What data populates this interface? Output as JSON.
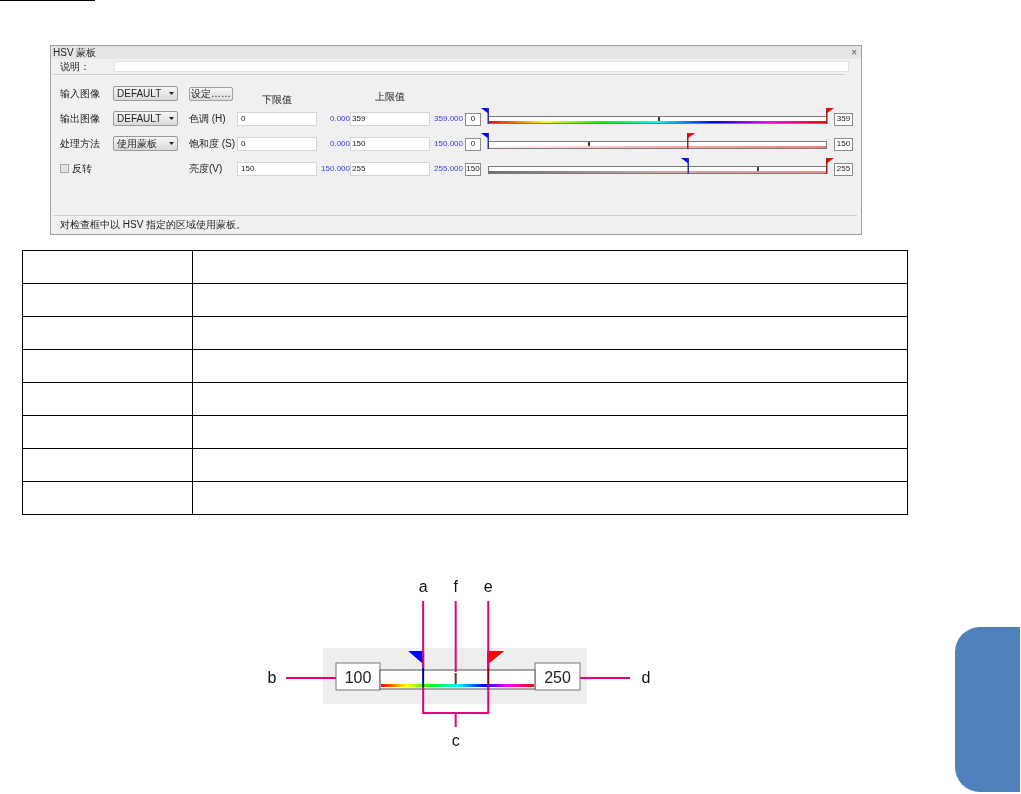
{
  "dialog": {
    "title": "HSV 蒙板",
    "close": "×",
    "description": {
      "label": "说明："
    },
    "left_rows": [
      {
        "kind": "dropdown",
        "label": "输入图像",
        "value": "DEFAULT"
      },
      {
        "kind": "dropdown",
        "label": "输出图像",
        "value": "DEFAULT"
      },
      {
        "kind": "dropdown",
        "label": "处理方法",
        "value": "使用蒙板"
      },
      {
        "kind": "checkbox",
        "label": "反转",
        "checked": false
      }
    ],
    "settings_button": "设定……",
    "headers": {
      "low": "下限值",
      "high": "上限值"
    },
    "channels": [
      {
        "label": "色调 (H)",
        "low": "0",
        "low_reading": "0.000",
        "high": "359",
        "high_reading": "359.000",
        "slider": {
          "kind": "hue",
          "min_box": "0",
          "max_box": "359",
          "low_thumb": {
            "level": 0
          },
          "high_thumb": {
            "level": 1
          }
        }
      },
      {
        "label": "饱和度 (S)",
        "low": "0",
        "low_reading": "0.000",
        "high": "150",
        "high_reading": "150.000",
        "slider": {
          "kind": "saturation",
          "min_box": "0",
          "max_box": "150",
          "low_thumb": {
            "level": 0
          },
          "high_thumb": {
            "level": 0.59
          }
        }
      },
      {
        "label": "亮度(V)",
        "low": "150",
        "low_reading": "150.000",
        "high": "255",
        "high_reading": "255.000",
        "slider": {
          "kind": "value",
          "min_box": "150",
          "max_box": "255",
          "low_thumb": {
            "level": 0.59
          },
          "high_thumb": {
            "level": 1
          }
        }
      }
    ],
    "status": "对检查框中以 HSV 指定的区域使用蒙板。"
  },
  "diagram": {
    "min_box": "100",
    "max_box": "250",
    "low_thumb": {
      "level": 0.23
    },
    "high_thumb": {
      "level": 0.75
    },
    "callouts": [
      {
        "kind": "low_thumb",
        "label": "a"
      },
      {
        "kind": "midpoint",
        "label": "f"
      },
      {
        "kind": "high_thumb",
        "label": "e"
      },
      {
        "kind": "min_box",
        "label": "b"
      },
      {
        "kind": "max_box",
        "label": "d"
      },
      {
        "kind": "range",
        "label": "c"
      }
    ]
  }
}
